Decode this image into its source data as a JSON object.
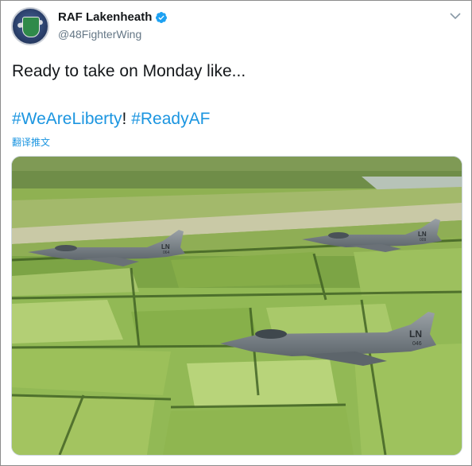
{
  "tweet": {
    "author_name": "RAF Lakenheath",
    "author_handle": "@48FighterWing",
    "verified_icon": "verified-badge-icon",
    "menu_icon": "chevron-down-icon",
    "text": "Ready to take on Monday like...",
    "hashtag_1": "#WeAreLiberty",
    "separator": "! ",
    "hashtag_2": "#ReadyAF",
    "translate_label": "翻译推文"
  },
  "media": {
    "jets": [
      {
        "tail_code": "LN",
        "tail_number": "064"
      },
      {
        "tail_code": "LN",
        "tail_number": "009"
      },
      {
        "tail_code": "LN",
        "tail_number": "046"
      }
    ]
  },
  "colors": {
    "link": "#1b95e0",
    "text": "#14171a",
    "secondary": "#657786",
    "verified": "#1da1f2"
  }
}
